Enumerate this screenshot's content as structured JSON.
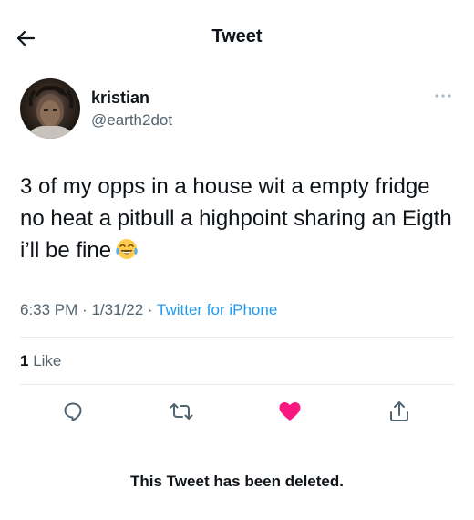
{
  "header": {
    "title": "Tweet",
    "back_icon": "arrow-left-icon"
  },
  "author": {
    "name": "kristian",
    "handle": "@earth2dot",
    "avatar_icon": "avatar"
  },
  "tweet": {
    "text": "3 of my opps in a house wit a empty fridge no heat a pitbull a highpoint sharing an Eigth i’ll be fine",
    "emoji_icon": "tears-of-joy-emoji-icon"
  },
  "meta": {
    "time": "6:33 PM",
    "date": "1/31/22",
    "separator": "·",
    "source": "Twitter for iPhone"
  },
  "likes": {
    "count": "1",
    "label": "Like"
  },
  "actions": {
    "reply_icon": "reply-icon",
    "retweet_icon": "retweet-icon",
    "like_icon": "heart-icon",
    "share_icon": "share-icon",
    "like_color": "#f91880"
  },
  "footer": {
    "deleted_text": "This Tweet has been deleted."
  },
  "colors": {
    "text_primary": "#0f1419",
    "text_secondary": "#536471",
    "link": "#1d9bf0",
    "divider": "#e6ecf0"
  }
}
